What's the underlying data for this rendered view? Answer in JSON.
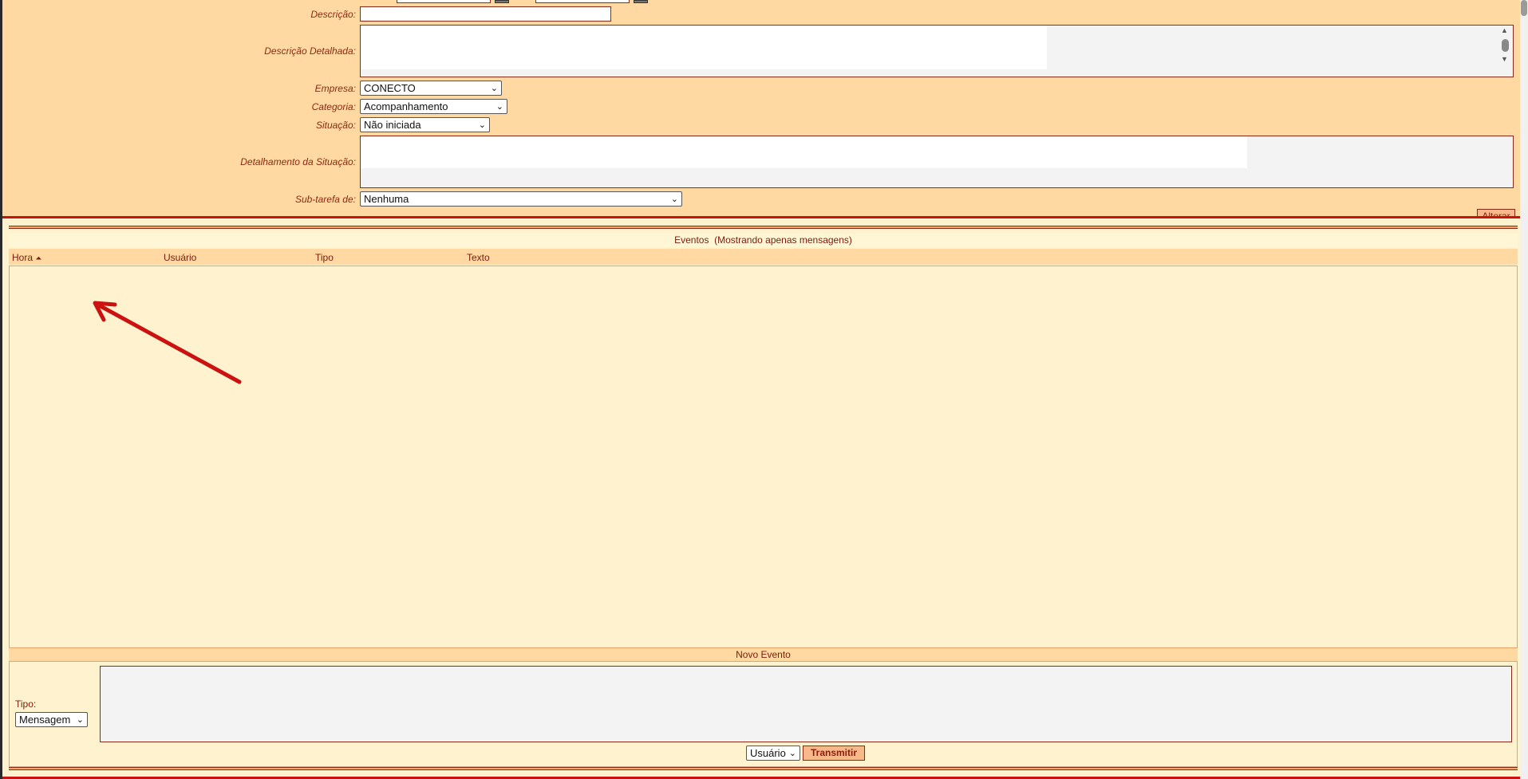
{
  "form": {
    "descricao_label": "Descrição:",
    "descricao_value": "",
    "descricao_detalhada_label": "Descrição Detalhada:",
    "empresa_label": "Empresa:",
    "empresa_value": "CONECTO",
    "categoria_label": "Categoria:",
    "categoria_value": "Acompanhamento",
    "situacao_label": "Situação:",
    "situacao_value": "Não iniciada",
    "detalhamento_label": "Detalhamento da Situação:",
    "subtarefa_label": "Sub-tarefa de:",
    "subtarefa_value": "Nenhuma",
    "alterar_label": "Alterar"
  },
  "events": {
    "title": "Eventos  (Mostrando apenas mensagens)",
    "columns": [
      "Hora",
      "Usuário",
      "Tipo",
      "Texto"
    ],
    "sort_indicator": "⏶"
  },
  "novo_evento": {
    "title": "Novo Evento",
    "tipo_label": "Tipo:",
    "tipo_value": "Mensagem",
    "target_value": "Usuário",
    "transmit_label": "Transmitir"
  },
  "annotation": {
    "color": "#cc1111"
  }
}
